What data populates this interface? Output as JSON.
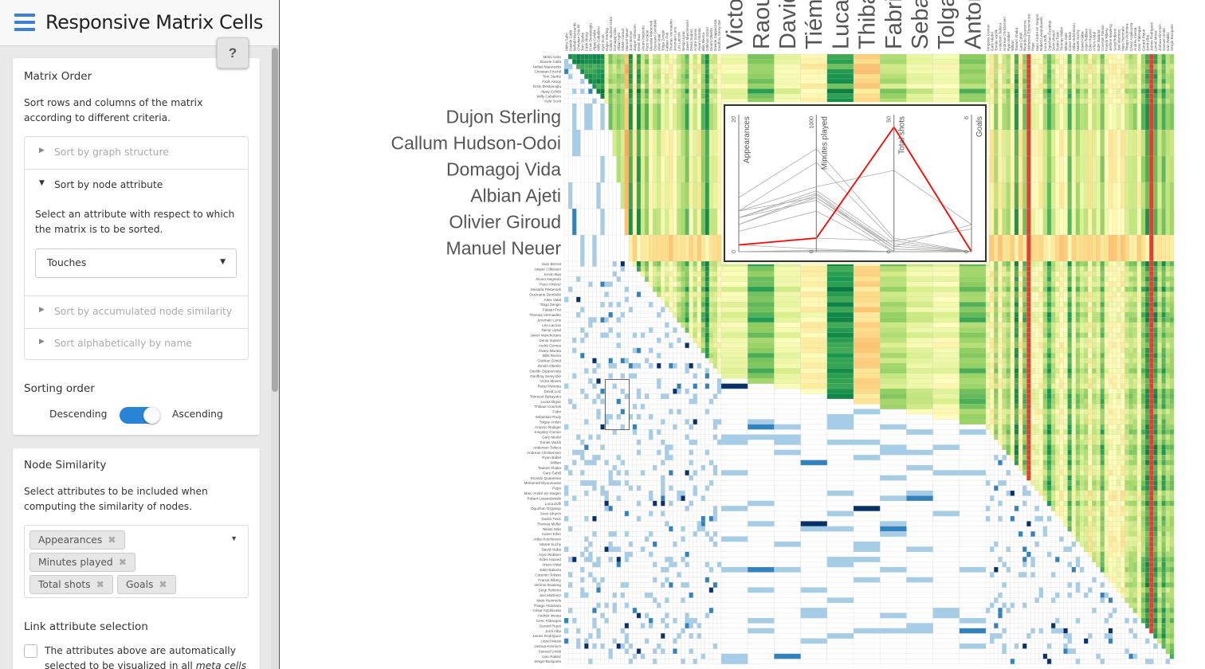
{
  "app": {
    "title": "Responsive Matrix Cells",
    "help_label": "?"
  },
  "matrix_order": {
    "heading": "Matrix Order",
    "description": "Sort rows and columns of the matrix according to different criteria.",
    "items": [
      {
        "label": "Sort by graph structure",
        "expanded": false
      },
      {
        "label": "Sort by node attribute",
        "expanded": true,
        "description": "Select an attribute with respect to which the matrix is to be sorted.",
        "selected": "Touches"
      },
      {
        "label": "Sort by accumulated node similarity",
        "expanded": false
      },
      {
        "label": "Sort alphabetically by name",
        "expanded": false
      }
    ],
    "sorting_order": {
      "heading": "Sorting order",
      "left": "Descending",
      "right": "Ascending",
      "value": "Ascending"
    }
  },
  "node_similarity": {
    "heading": "Node Similarity",
    "description": "Select attributes to be included when computing the similarity of nodes.",
    "tags": [
      "Appearances",
      "Minutes played",
      "Total shots",
      "Goals"
    ],
    "link_heading": "Link attribute selection",
    "link_checked": false,
    "link_text": "The attributes above are automatically selected to be visualized in all ",
    "link_text_em": "meta cells"
  },
  "colors": {
    "accent": "#2a84d6",
    "highlight": "#ff0000",
    "link_light": "#a6cde8",
    "link_dark": "#08306b"
  },
  "matrix": {
    "highlight_node": "Manuel Neuer",
    "nodes": [
      "Mirko Salvi",
      "Davide Callà",
      "Neftali Manzambi",
      "Christian Früchtl",
      "Tom Starke",
      "Fatih Aksoy",
      "Ersin Destanoglu",
      "Alpay Celebi",
      "Willy Caballero",
      "Kyle Scott",
      "Dujon Sterling",
      "Callum Hudson-Odoi",
      "Domagoj Vida",
      "Albian Ajeti",
      "Olivier Giroud",
      "Manuel Neuer",
      "Juan Bernat",
      "Jasper Cillessen",
      "Kevin Bua",
      "Álvaro Negredo",
      "Paco Alcácer",
      "Mustafa Pektemek",
      "Ousmane Dembélé",
      "Aleix Vidal",
      "Tolga Zengin",
      "Fabian Frei",
      "Thomas Vermaelen",
      "Jeremain Lens",
      "Léo Lacroix",
      "Necip Uysal",
      "Javier Mascherano",
      "Denis Suárez",
      "André Gomes",
      "Álvaro Morata",
      "Bilis Rivera",
      "Gökhan Gönül",
      "Dimitri Oberlin",
      "Davide Zappacosta",
      "Geoffroy Serey Dié",
      "Victor Moses",
      "Raoul Petretta",
      "David Luiz",
      "Tiémoué Bakayoko",
      "Lucas Digne",
      "Thibaut Courtois",
      "Fabri",
      "Sebastian Rudy",
      "Tolgay Arslan",
      "Antonio Rüdiger",
      "Kingsley Coman",
      "Gary Medel",
      "Tomás Vaclík",
      "Anderson Talisca",
      "Andreas Christensen",
      "Ryan Babel",
      "Willian",
      "Taulant Xhaka",
      "Gary Cahill",
      "Ricardo Quaresma",
      "Mohamed Elyounoussi",
      "Pepe",
      "Marc-André ter Stegen",
      "Robert Lewandowski",
      "Luca Zuffi",
      "Oguzhan Özyakup",
      "Sven Ulreich",
      "Dusko Tosic",
      "Thomas Müller",
      "Niklas Süle",
      "Caner Erkin",
      "Atiba Hutchinson",
      "Marek Suchy",
      "David Alaba",
      "Arjen Robben",
      "Eden Hazard",
      "Arturo Vidal",
      "Eder Balanta",
      "Corentin Tolisso",
      "Franck Ribéry",
      "Jérôme Boateng",
      "Sergi Roberto",
      "Javi Martínez",
      "Mats Hummels",
      "Thiago Alcántara",
      "César Azpilicueta",
      "Andrés Iniesta",
      "Cesc Fàbregas",
      "Gerard Piqué",
      "Jordi Alba",
      "James Rodríguez",
      "Lionel Messi",
      "Joshua Kimmich",
      "Samuel Umtiti",
      "Ivan Rakitić",
      "Sergio Busquets"
    ]
  },
  "parallel_coords": {
    "axes": [
      {
        "name": "Appearances",
        "min": 0,
        "max": 20
      },
      {
        "name": "Minutes played",
        "min": 0,
        "max": 1000
      },
      {
        "name": "Total shots",
        "min": 0,
        "max": 50
      },
      {
        "name": "Goals",
        "min": 0,
        "max": 6
      }
    ],
    "highlight": [
      1,
      100,
      46,
      0
    ],
    "others": [
      [
        8,
        760,
        5,
        0
      ],
      [
        6,
        660,
        4,
        0
      ],
      [
        6,
        480,
        30,
        1.2
      ],
      [
        5,
        450,
        3,
        0
      ],
      [
        5,
        430,
        2,
        1.2
      ],
      [
        4,
        420,
        1,
        0
      ],
      [
        4,
        400,
        2,
        0
      ],
      [
        6,
        400,
        1,
        0
      ],
      [
        3,
        300,
        0,
        0
      ],
      [
        1,
        100,
        4,
        1
      ],
      [
        1,
        20,
        0,
        0
      ],
      [
        0,
        10,
        0,
        0
      ],
      [
        5,
        380,
        0,
        0
      ]
    ]
  }
}
